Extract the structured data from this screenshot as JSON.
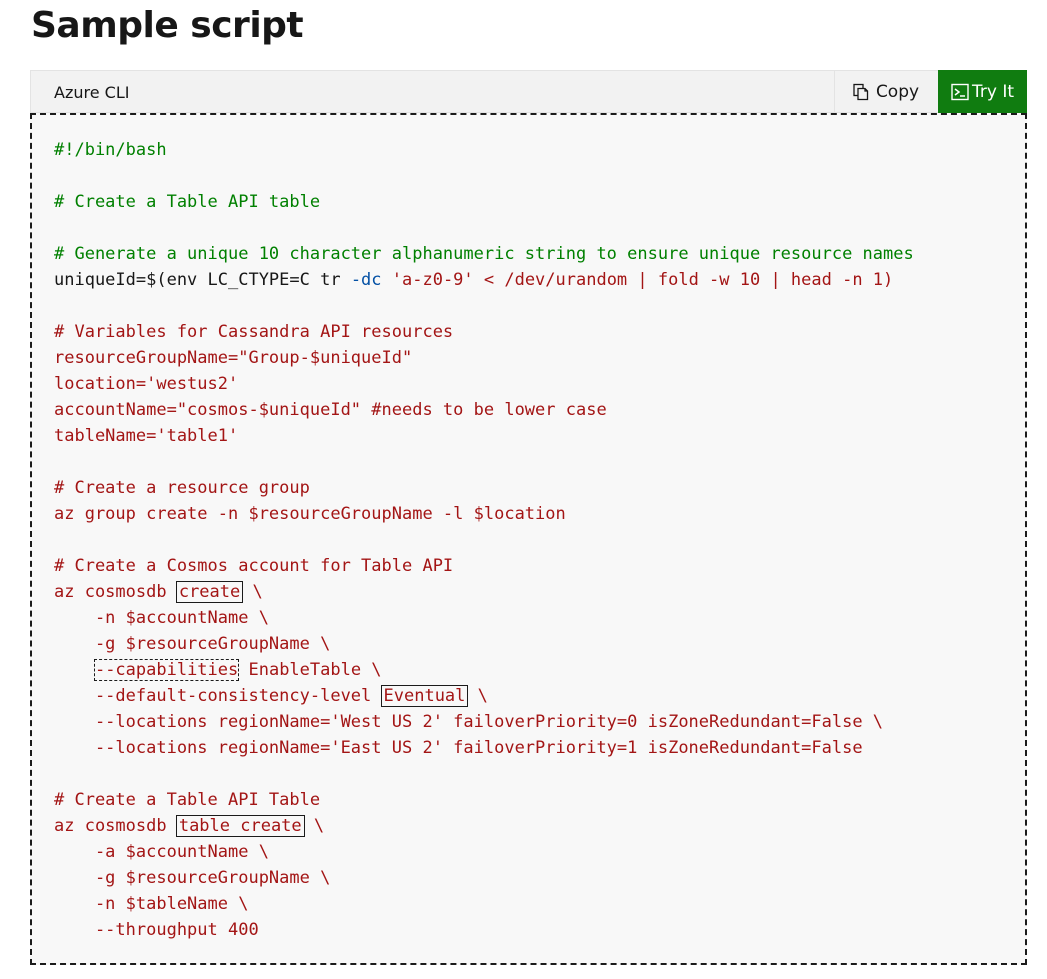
{
  "page": {
    "title": "Sample script"
  },
  "toolbar": {
    "language": "Azure CLI",
    "copy_label": "Copy",
    "try_label": "Try It"
  },
  "colors": {
    "try_button_bg": "#107c10",
    "comment": "#008000",
    "string": "#a31515",
    "flag": "#0451a5"
  },
  "code": {
    "lines": [
      [
        {
          "t": "#!/bin/bash",
          "c": "comment"
        }
      ],
      [],
      [
        {
          "t": "# Create a Table API table",
          "c": "comment"
        }
      ],
      [],
      [
        {
          "t": "# Generate a unique 10 character alphanumeric string to ensure unique resource names",
          "c": "comment"
        }
      ],
      [
        {
          "t": "uniqueId=$(env LC_CTYPE=C tr ",
          "c": "plain"
        },
        {
          "t": "-dc",
          "c": "flag"
        },
        {
          "t": " 'a-z0-9' < /dev/urandom | fold -w 10 | head -n 1)",
          "c": "str"
        }
      ],
      [],
      [
        {
          "t": "# Variables for Cassandra API resources",
          "c": "str"
        }
      ],
      [
        {
          "t": "resourceGroupName=\"Group-$uniqueId\"",
          "c": "str"
        }
      ],
      [
        {
          "t": "location='westus2'",
          "c": "str"
        }
      ],
      [
        {
          "t": "accountName=\"cosmos-$uniqueId\" #needs to be lower case",
          "c": "str"
        }
      ],
      [
        {
          "t": "tableName='table1'",
          "c": "str"
        }
      ],
      [],
      [
        {
          "t": "# Create a resource group",
          "c": "str"
        }
      ],
      [
        {
          "t": "az group create -n $resourceGroupName -l $location",
          "c": "str"
        }
      ],
      [],
      [
        {
          "t": "# Create a Cosmos account for Table API",
          "c": "str"
        }
      ],
      [
        {
          "t": "az cosmosdb ",
          "c": "str"
        },
        {
          "t": "create",
          "c": "str",
          "box": "solid"
        },
        {
          "t": " \\",
          "c": "str"
        }
      ],
      [
        {
          "t": "    -n $accountName \\",
          "c": "str"
        }
      ],
      [
        {
          "t": "    -g $resourceGroupName \\",
          "c": "str"
        }
      ],
      [
        {
          "t": "    ",
          "c": "str"
        },
        {
          "t": "--capabilities",
          "c": "str",
          "box": "dashed"
        },
        {
          "t": " EnableTable \\",
          "c": "str"
        }
      ],
      [
        {
          "t": "    --default-consistency-level ",
          "c": "str"
        },
        {
          "t": "Eventual",
          "c": "str",
          "box": "solid"
        },
        {
          "t": " \\",
          "c": "str"
        }
      ],
      [
        {
          "t": "    --locations regionName='West US 2' failoverPriority=0 isZoneRedundant=False \\",
          "c": "str"
        }
      ],
      [
        {
          "t": "    --locations regionName='East US 2' failoverPriority=1 isZoneRedundant=False",
          "c": "str"
        }
      ],
      [],
      [
        {
          "t": "# Create a Table API Table",
          "c": "str"
        }
      ],
      [
        {
          "t": "az cosmosdb ",
          "c": "str"
        },
        {
          "t": "table create",
          "c": "str",
          "box": "solid"
        },
        {
          "t": " \\",
          "c": "str"
        }
      ],
      [
        {
          "t": "    -a $accountName \\",
          "c": "str"
        }
      ],
      [
        {
          "t": "    -g $resourceGroupName \\",
          "c": "str"
        }
      ],
      [
        {
          "t": "    -n $tableName \\",
          "c": "str"
        }
      ],
      [
        {
          "t": "    --throughput 400",
          "c": "str"
        }
      ]
    ]
  }
}
